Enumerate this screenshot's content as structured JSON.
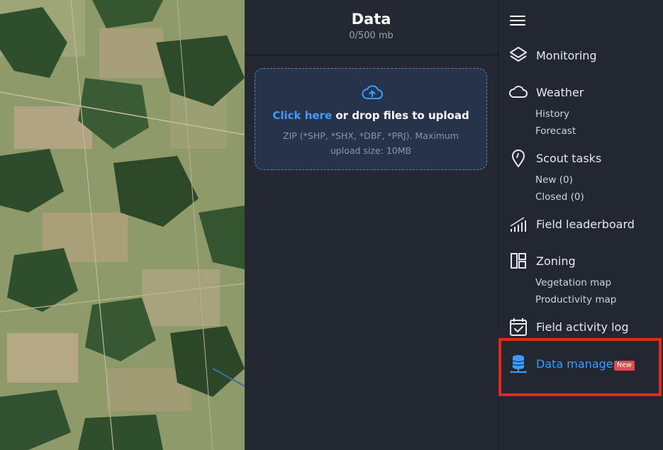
{
  "data_panel": {
    "title": "Data",
    "quota": "0/500 mb",
    "dropzone": {
      "link_text": "Click here",
      "text": " or drop files to upload",
      "hint": "ZIP (*SHP, *SHX, *DBF, *PRJ). Maximum upload size: 10MB"
    }
  },
  "sidebar": {
    "items": [
      {
        "label": "Monitoring",
        "icon": "layers-icon"
      },
      {
        "label": "Weather",
        "icon": "cloud-icon",
        "sub": [
          "History",
          "Forecast"
        ]
      },
      {
        "label": "Scout tasks",
        "icon": "location-pin-icon",
        "sub": [
          "New (0)",
          "Closed (0)"
        ]
      },
      {
        "label": "Field leaderboard",
        "icon": "bar-chart-icon"
      },
      {
        "label": "Zoning",
        "icon": "grid-layout-icon",
        "sub": [
          "Vegetation map",
          "Productivity map"
        ]
      },
      {
        "label": "Field activity log",
        "icon": "calendar-check-icon"
      },
      {
        "label": "Data manager",
        "icon": "database-icon",
        "badge": "New",
        "active": true
      }
    ]
  },
  "colors": {
    "accent": "#3f9cff",
    "badge": "#e5484d",
    "highlight": "#e12b18",
    "panel_bg": "#232833"
  }
}
